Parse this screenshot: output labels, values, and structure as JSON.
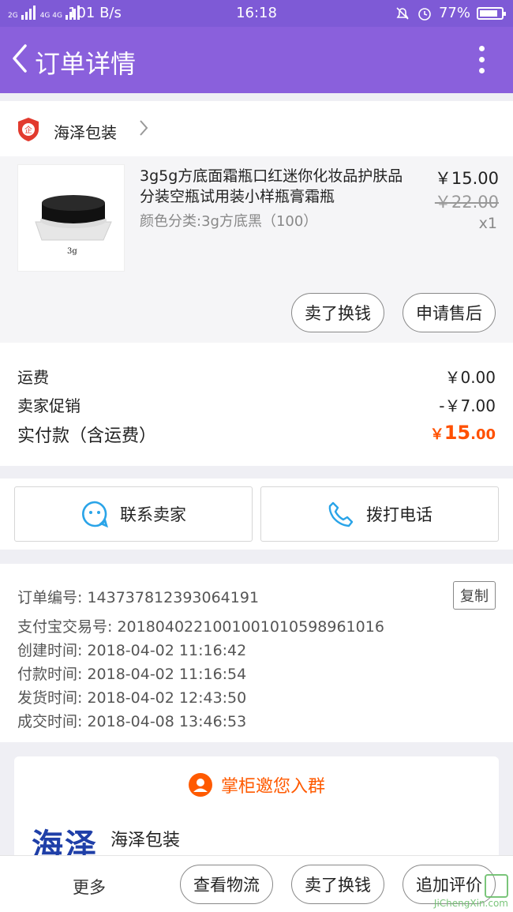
{
  "status_bar": {
    "network_left": "2G",
    "network_mid": "4G 4G",
    "speed": "101 B/s",
    "time": "16:18",
    "battery": "77%"
  },
  "header": {
    "title": "订单详情"
  },
  "shop": {
    "name": "海泽包装"
  },
  "product": {
    "title": "3g5g方底面霜瓶口红迷你化妆品护肤品分装空瓶试用装小样瓶膏霜瓶",
    "sku": "颜色分类:3g方底黑（100）",
    "price": "￥15.00",
    "original_price": "￥22.00",
    "quantity": "x1",
    "thumb_label": "3g",
    "buttons": {
      "sell": "卖了换钱",
      "after_sale": "申请售后"
    }
  },
  "fees": {
    "shipping_label": "运费",
    "shipping_value": "￥0.00",
    "promo_label": "卖家促销",
    "promo_value": "-￥7.00",
    "total_label": "实付款（含运费）",
    "total_currency": "￥",
    "total_int": "15",
    "total_dec": ".00"
  },
  "contact": {
    "seller": "联系卖家",
    "call": "拨打电话"
  },
  "order_info": {
    "order_no": "订单编号: 143737812393064191",
    "alipay_no": "支付宝交易号: 2018040221001001010598961016",
    "created": "创建时间: 2018-04-02 11:16:42",
    "paid": "付款时间: 2018-04-02 11:16:54",
    "shipped": "发货时间: 2018-04-02 12:43:50",
    "completed": "成交时间: 2018-04-08 13:46:53",
    "copy": "复制"
  },
  "group": {
    "invite": "掌柜邀您入群",
    "shop_logo_text": "海泽",
    "shop_name": "海泽包装"
  },
  "bottom_bar": {
    "more": "更多",
    "logistics": "查看物流",
    "sell": "卖了换钱",
    "review": "追加评价"
  },
  "watermark": {
    "site": "JiChengXin.com"
  },
  "colors": {
    "header": "#8a60dc",
    "accent": "#ff5000"
  }
}
